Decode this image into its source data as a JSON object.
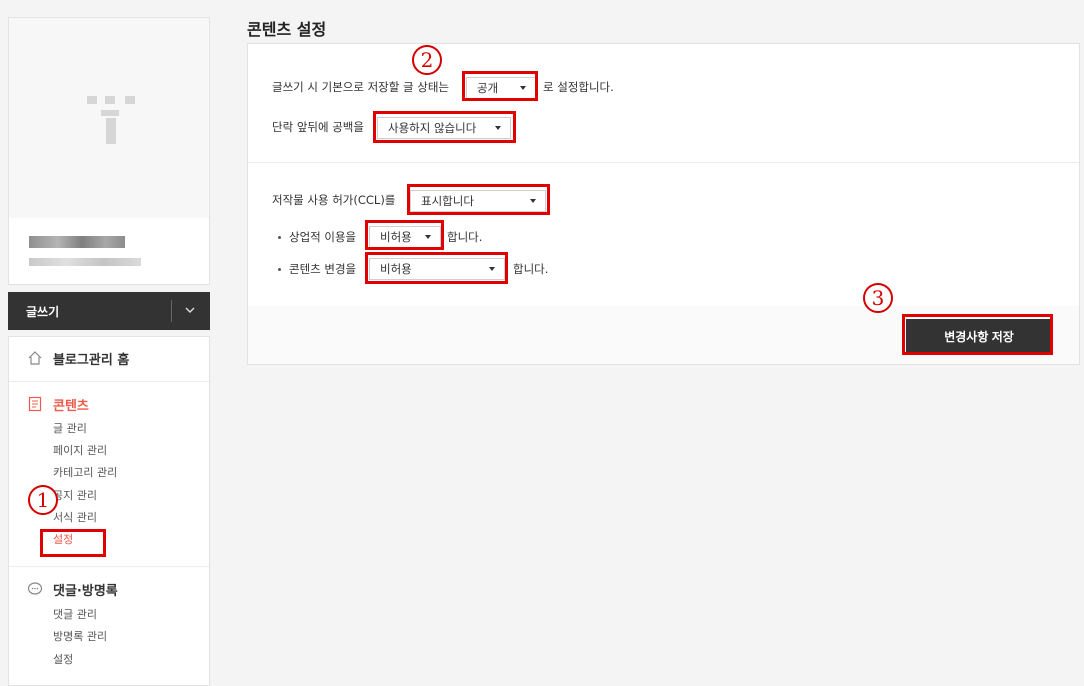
{
  "sidebar": {
    "write_button": "글쓰기",
    "home_label": "블로그관리 홈",
    "contents": {
      "label": "콘텐츠",
      "items": [
        "글 관리",
        "페이지 관리",
        "카테고리 관리",
        "공지 관리",
        "서식 관리",
        "설정"
      ]
    },
    "comments": {
      "label": "댓글·방명록",
      "items": [
        "댓글 관리",
        "방명록 관리",
        "설정"
      ]
    }
  },
  "page": {
    "title": "콘텐츠 설정"
  },
  "settings": {
    "default_status": {
      "prefix": "글쓰기 시 기본으로 저장할 글 상태는",
      "value": "공개",
      "suffix": "로 설정합니다."
    },
    "paragraph_spacing": {
      "prefix": "단락 앞뒤에 공백을",
      "value": "사용하지 않습니다"
    },
    "ccl": {
      "prefix": "저작물 사용 허가(CCL)를",
      "value": "표시합니다"
    },
    "commercial": {
      "prefix": "상업적 이용을",
      "value": "비허용",
      "suffix": "합니다."
    },
    "modification": {
      "prefix": "콘텐츠 변경을",
      "value": "비허용",
      "suffix": "합니다."
    },
    "save_label": "변경사항 저장"
  },
  "annotations": {
    "step1": "1",
    "step2": "2",
    "step3": "3",
    "highlight_color": "#e10000"
  },
  "colors": {
    "accent": "#ef5a4a",
    "dark": "#333333"
  }
}
